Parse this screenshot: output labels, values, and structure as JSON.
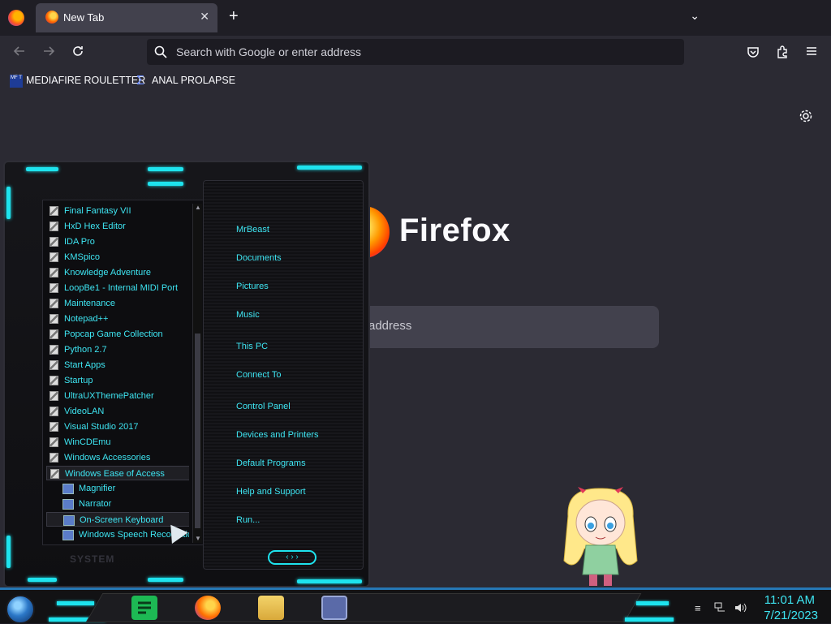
{
  "browser": {
    "tab": {
      "title": "New Tab",
      "close": "✕"
    },
    "new_tab": "+",
    "tab_list": "⌄",
    "url_placeholder": "Search with Google or enter address",
    "bookmarks": [
      {
        "label": "MEDIAFIRE ROULETTER",
        "icon_text": "MF T"
      },
      {
        "label": "ANAL PROLAPSE",
        "icon_text": "Σ"
      }
    ],
    "newtab_wordmark": "Firefox",
    "big_search_placeholder": "address"
  },
  "start_menu": {
    "programs": [
      "Final Fantasy VII",
      "HxD Hex Editor",
      "IDA Pro",
      "KMSpico",
      "Knowledge Adventure",
      "LoopBe1 - Internal MIDI Port",
      "Maintenance",
      "Notepad++",
      "Popcap Game Collection",
      "Python 2.7",
      "Start Apps",
      "Startup",
      "UltraUXThemePatcher",
      "VideoLAN",
      "Visual Studio 2017",
      "WinCDEmu",
      "Windows Accessories",
      "Windows Ease of Access"
    ],
    "sub_programs": [
      "Magnifier",
      "Narrator",
      "On-Screen Keyboard",
      "Windows Speech Recognition"
    ],
    "places": [
      "MrBeast",
      "Documents",
      "Pictures",
      "Music",
      "This PC",
      "Connect To",
      "Control Panel",
      "Devices and Printers",
      "Default Programs",
      "Help and Support",
      "Run..."
    ],
    "footer_label": "SYSTEM",
    "nav_arrows": "‹ › ›"
  },
  "taskbar": {
    "time": "11:01 AM",
    "date": "7/21/2023"
  },
  "colors": {
    "accent_cyan": "#1ee3ee",
    "menu_text": "#3ee5f2",
    "browser_bg": "#2b2a33"
  }
}
